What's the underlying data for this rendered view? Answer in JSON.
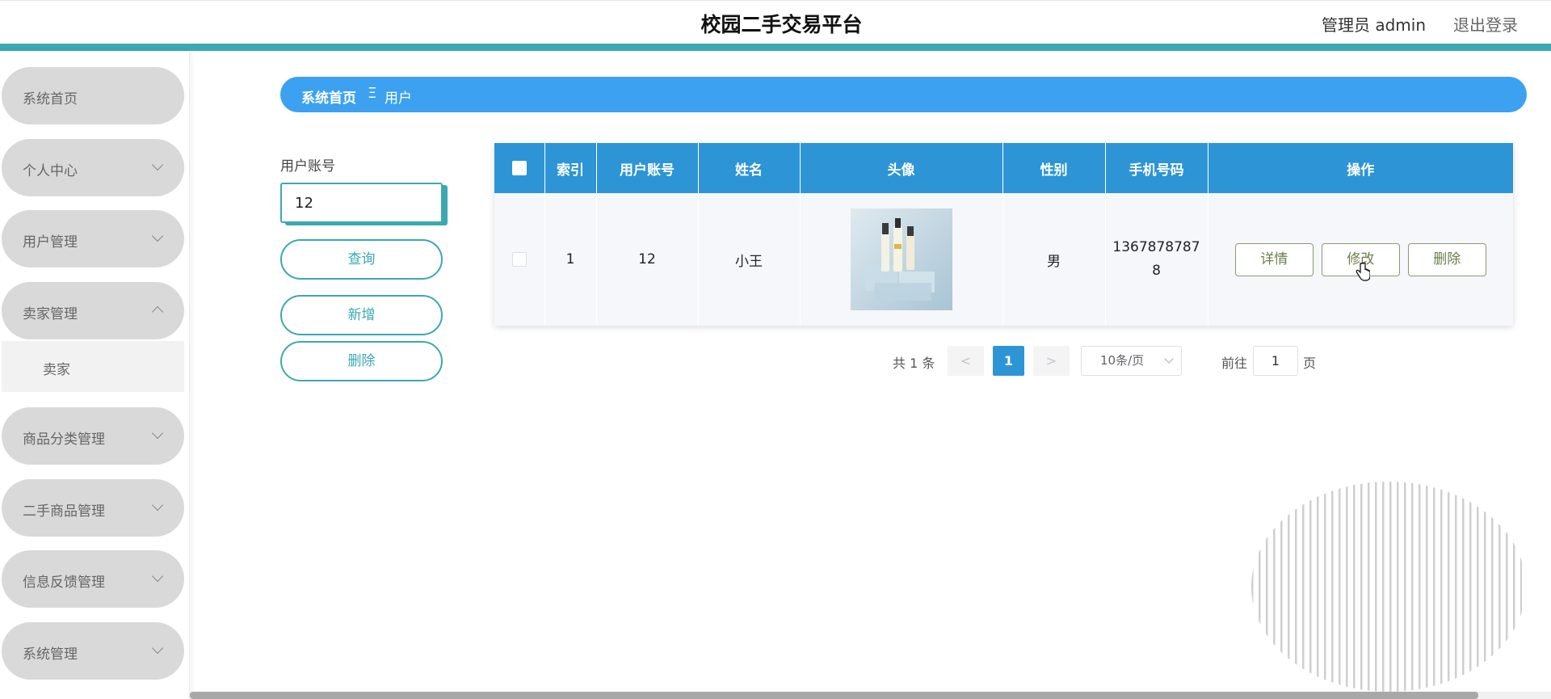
{
  "header": {
    "title": "校园二手交易平台",
    "user": "管理员 admin",
    "logout": "退出登录"
  },
  "sidebar": {
    "items": [
      {
        "label": "系统首页",
        "has_chevron": false
      },
      {
        "label": "个人中心",
        "has_chevron": true
      },
      {
        "label": "用户管理",
        "has_chevron": true
      },
      {
        "label": "卖家管理",
        "has_chevron": true,
        "expanded": true
      },
      {
        "label": "商品分类管理",
        "has_chevron": true
      },
      {
        "label": "二手商品管理",
        "has_chevron": true
      },
      {
        "label": "信息反馈管理",
        "has_chevron": true
      },
      {
        "label": "系统管理",
        "has_chevron": true
      }
    ],
    "submenu": {
      "label": "卖家"
    }
  },
  "breadcrumb": {
    "home": "系统首页",
    "separator": "Ξ",
    "current": "用户"
  },
  "search": {
    "label": "用户账号",
    "value": "12",
    "query_button": "查询",
    "add_button": "新增",
    "delete_button": "删除"
  },
  "table": {
    "columns": [
      "索引",
      "用户账号",
      "姓名",
      "头像",
      "性别",
      "手机号码",
      "操作"
    ],
    "rows": [
      {
        "index": "1",
        "account": "12",
        "name": "小王",
        "avatar": "product-photo",
        "gender": "男",
        "phone": "13678787878"
      }
    ],
    "actions": {
      "detail": "详情",
      "edit": "修改",
      "delete": "删除"
    }
  },
  "pagination": {
    "total": "共 1 条",
    "prev": "<",
    "current_page": "1",
    "next": ">",
    "page_size": "10条/页",
    "goto_label": "前往",
    "goto_value": "1",
    "page_suffix": "页"
  },
  "colors": {
    "accent_teal": "#3aa9b2",
    "breadcrumb_blue": "#3ca1f0",
    "table_header": "#2d95d6",
    "sidebar_item": "#d9d9d9"
  }
}
